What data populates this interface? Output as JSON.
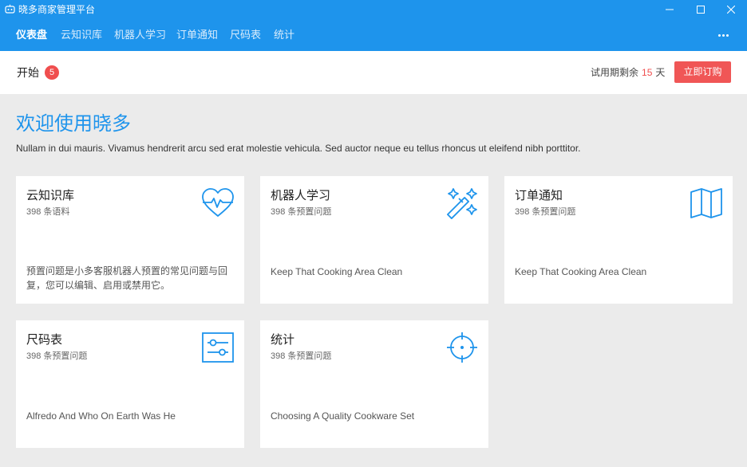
{
  "window": {
    "title": "晓多商家管理平台",
    "icons": [
      "robot-icon",
      "minimize-icon",
      "maximize-icon",
      "close-icon"
    ]
  },
  "nav": {
    "items": [
      "仪表盘",
      "云知识库",
      "机器人学习",
      "订单通知",
      "尺码表",
      "统计"
    ],
    "active_index": 0,
    "more_icon": "more-icon"
  },
  "subbar": {
    "start_label": "开始",
    "badge_count": "5",
    "trial_prefix": "试用期剩余",
    "trial_days": "15",
    "trial_suffix": "天",
    "buy_label": "立即订购"
  },
  "hero": {
    "title": "欢迎使用晓多",
    "subtitle": "Nullam in dui mauris. Vivamus hendrerit arcu sed erat molestie vehicula. Sed auctor neque eu tellus rhoncus ut eleifend nibh porttitor."
  },
  "cards": [
    {
      "title": "云知识库",
      "meta": "398 条语料",
      "desc": "预置问题是小多客服机器人预置的常见问题与回复，您可以编辑、启用或禁用它。",
      "icon": "heartbeat-icon"
    },
    {
      "title": "机器人学习",
      "meta": "398 条预置问题",
      "desc": "Keep That Cooking Area Clean",
      "icon": "magic-wand-icon"
    },
    {
      "title": "订单通知",
      "meta": "398 条预置问题",
      "desc": "Keep That Cooking Area Clean",
      "icon": "open-book-icon"
    },
    {
      "title": "尺码表",
      "meta": "398 条预置问题",
      "desc": "Alfredo And Who On Earth Was He",
      "icon": "sliders-icon"
    },
    {
      "title": "统计",
      "meta": "398 条预置问题",
      "desc": "Choosing A Quality Cookware Set",
      "icon": "crosshair-icon"
    }
  ],
  "colors": {
    "brand_blue": "#1e94ec",
    "accent_red": "#f05656",
    "background": "#ebebeb"
  }
}
